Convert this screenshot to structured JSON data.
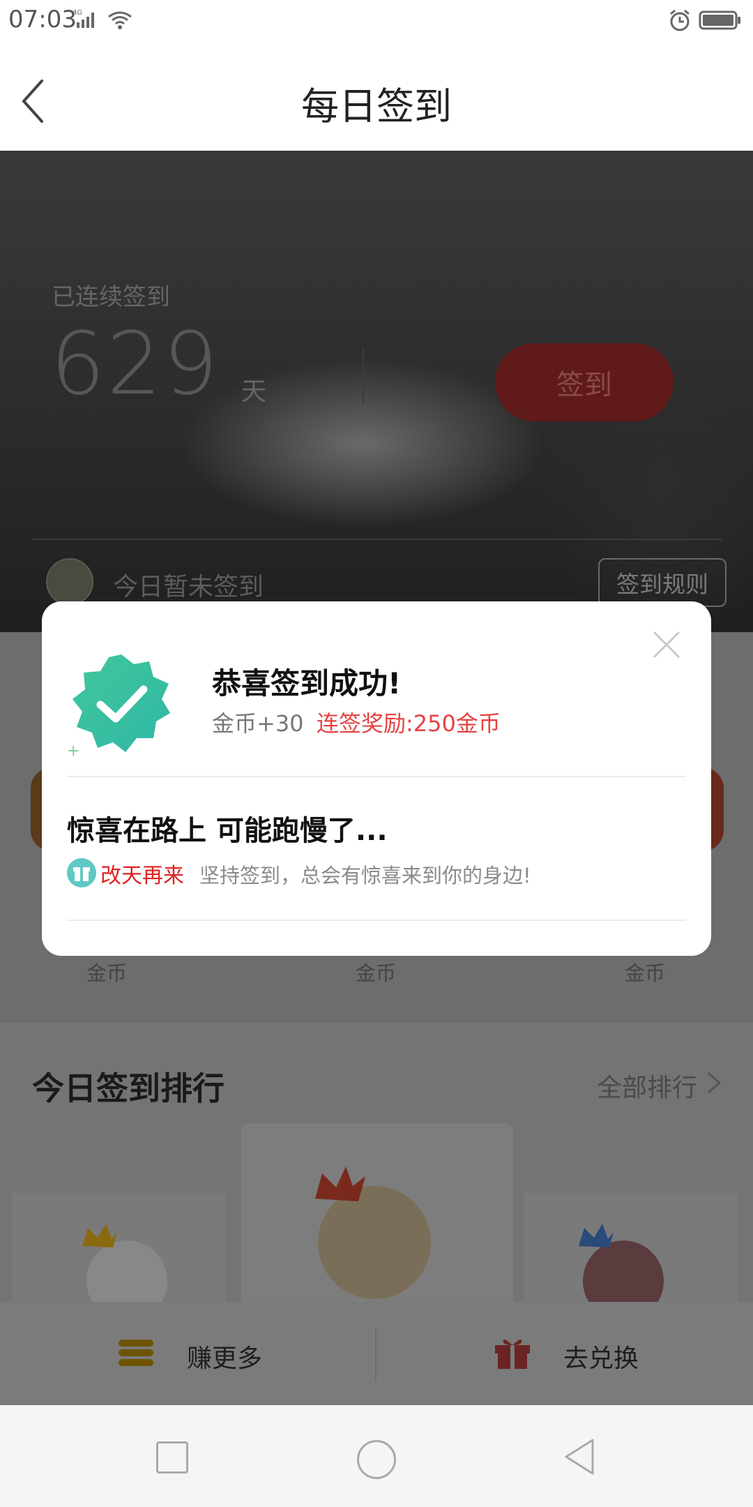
{
  "status_bar": {
    "time": "07:03",
    "network": "4G"
  },
  "header": {
    "title": "每日签到"
  },
  "hero": {
    "streak_label": "已连续签到",
    "streak_days": "629",
    "streak_unit": "天",
    "checkin_button": "签到",
    "today_status": "今日暂未签到",
    "rules_button": "签到规则"
  },
  "coins_row": {
    "labels": [
      "金币",
      "金币",
      "金币"
    ]
  },
  "ranking": {
    "title": "今日签到排行",
    "all_link": "全部排行"
  },
  "bottom_actions": {
    "earn_more": "赚更多",
    "redeem": "去兑换"
  },
  "modal": {
    "title": "恭喜签到成功!",
    "coin_reward": "金币+30",
    "streak_reward": "连签奖励:250金币",
    "surprise_title": "惊喜在路上 可能跑慢了...",
    "come_back": "改天再来",
    "keep_text": "坚持签到，总会有惊喜来到你的身边!"
  },
  "colors": {
    "accent_red": "#e64242",
    "success_green": "#3cc3a0",
    "gold": "#f2b600"
  }
}
